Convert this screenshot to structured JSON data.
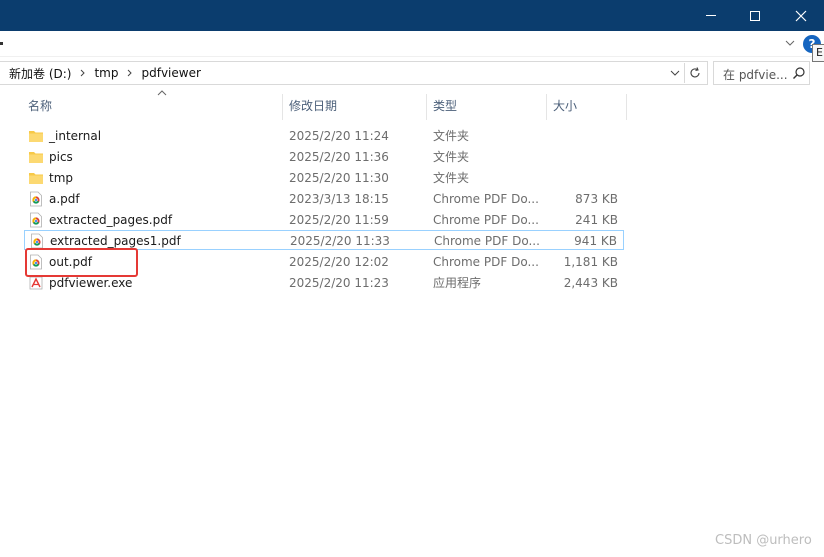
{
  "window": {
    "minimize_icon": "minimize-icon",
    "maximize_icon": "maximize-icon",
    "close_icon": "close-icon",
    "titlebar_color": "#0b3d6e"
  },
  "ribbon": {
    "help_glyph": "?",
    "tooltip_text": "E"
  },
  "address": {
    "crumbs": [
      "新加卷 (D:)",
      "tmp",
      "pdfviewer"
    ]
  },
  "search": {
    "text": "在 pdfvie..."
  },
  "columns": {
    "name": "名称",
    "date": "修改日期",
    "type": "类型",
    "size": "大小"
  },
  "files": [
    {
      "name": "_internal",
      "date": "2025/2/20 11:24",
      "type": "文件夹",
      "size": "",
      "icon": "folder-icon"
    },
    {
      "name": "pics",
      "date": "2025/2/20 11:36",
      "type": "文件夹",
      "size": "",
      "icon": "folder-icon"
    },
    {
      "name": "tmp",
      "date": "2025/2/20 11:30",
      "type": "文件夹",
      "size": "",
      "icon": "folder-icon"
    },
    {
      "name": "a.pdf",
      "date": "2023/3/13 18:15",
      "type": "Chrome PDF Do...",
      "size": "873 KB",
      "icon": "chrome-pdf-icon"
    },
    {
      "name": "extracted_pages.pdf",
      "date": "2025/2/20 11:59",
      "type": "Chrome PDF Do...",
      "size": "241 KB",
      "icon": "chrome-pdf-icon"
    },
    {
      "name": "extracted_pages1.pdf",
      "date": "2025/2/20 11:33",
      "type": "Chrome PDF Do...",
      "size": "941 KB",
      "icon": "chrome-pdf-icon"
    },
    {
      "name": "out.pdf",
      "date": "2025/2/20 12:02",
      "type": "Chrome PDF Do...",
      "size": "1,181 KB",
      "icon": "chrome-pdf-icon"
    },
    {
      "name": "pdfviewer.exe",
      "date": "2025/2/20 11:23",
      "type": "应用程序",
      "size": "2,443 KB",
      "icon": "exe-icon"
    }
  ],
  "watermark": "CSDN @urhero",
  "colors": {
    "highlight": "#e53935",
    "selection_border": "#99d1ff",
    "folder": "#f7c948"
  }
}
